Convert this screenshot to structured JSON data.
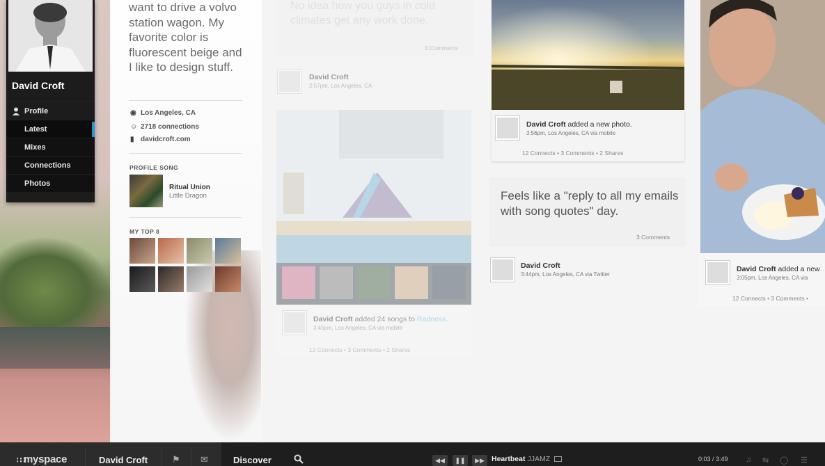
{
  "profile": {
    "name": "David Croft",
    "nav": [
      {
        "label": "Profile",
        "active": false
      },
      {
        "label": "Latest",
        "active": true
      },
      {
        "label": "Mixes",
        "active": false
      },
      {
        "label": "Connections",
        "active": false
      },
      {
        "label": "Photos",
        "active": false
      }
    ]
  },
  "about": {
    "bio": "want to drive a volvo station wagon. My favorite color is fluorescent beige and I like to design stuff.",
    "location": "Los Angeles, CA",
    "connections": "2718 connections",
    "website": "davidcroft.com",
    "profile_song_title": "PROFILE SONG",
    "song": {
      "title": "Ritual Union",
      "artist": "Little Dragon"
    },
    "top8_title": "MY TOP 8"
  },
  "feed": {
    "col1": {
      "post1_text": "No idea how you guys in cold climates get any work done.",
      "post1_comments": "3 Comments",
      "post1_name": "David Croft",
      "post1_time": "2:57pm, Los Angeles, CA",
      "post2_name": "David Croft",
      "post2_action": " added 24 songs to ",
      "post2_link": "Radness.",
      "post2_time": "3:45pm, Los Angeles, CA via mobile",
      "post2_stats": "12 Connects  •  3 Comments  •  2 Shares"
    },
    "col2": {
      "photo_name": "David Croft",
      "photo_action": " added a new photo.",
      "photo_time": "3:56pm, Los Angeles, CA via mobile",
      "photo_stats": "12 Connects  •  3 Comments  •  2 Shares",
      "tweet_text": "Feels like a \"reply to all my emails with song quotes\" day.",
      "tweet_comments": "3 Comments",
      "tweet_name": "David Croft",
      "tweet_time": "3:44pm, Los Angeles, CA via Twitter"
    },
    "col3": {
      "name": "David Croft",
      "action": " added a new",
      "time": "3:05pm, Los Angeles, CA via",
      "stats": "12 Connects  •  3 Comments  •"
    }
  },
  "bottombar": {
    "logo": "myspace",
    "user": "David Croft",
    "discover": "Discover",
    "track_title": "Heartbeat",
    "track_artist": "JJAMZ",
    "time": "0:03 / 3:49",
    "icons": [
      "flag-icon",
      "chat-icon",
      "search-icon",
      "rewind-icon",
      "pause-icon",
      "forward-icon",
      "volume-icon",
      "shuffle-icon",
      "chat-bubble-icon",
      "equalizer-icon"
    ]
  },
  "colors": {
    "accent": "#2a94d6",
    "bar": "#1e1e1e",
    "link": "#58b4e8"
  }
}
